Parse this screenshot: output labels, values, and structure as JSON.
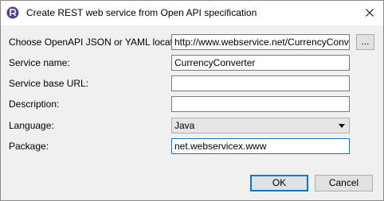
{
  "window": {
    "title": "Create REST web service from Open API specification",
    "close_glyph": "✕"
  },
  "form": {
    "location": {
      "label": "Choose OpenAPI JSON or YAML location:",
      "value": "http://www.webservice.net/CurrencyConvert",
      "browse_label": "..."
    },
    "service_name": {
      "label": "Service name:",
      "value": "CurrencyConverter"
    },
    "base_url": {
      "label": "Service base URL:",
      "value": ""
    },
    "description": {
      "label": "Description:",
      "value": ""
    },
    "language": {
      "label": "Language:",
      "selected": "Java"
    },
    "package": {
      "label": "Package:",
      "value": "net.webservicex.www"
    }
  },
  "buttons": {
    "ok": "OK",
    "cancel": "Cancel"
  },
  "colors": {
    "accent": "#0078d7",
    "dialog_bg": "#f0f0f0",
    "app_icon": "#5b3d8f"
  },
  "icons": {
    "app": "app-logo-icon",
    "close": "close-icon",
    "dropdown": "chevron-down-icon"
  }
}
